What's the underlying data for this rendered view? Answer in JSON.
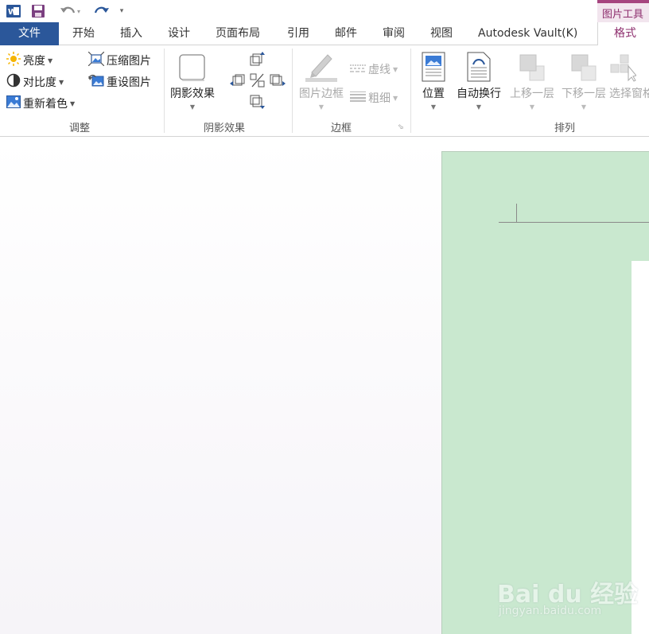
{
  "qat": {
    "app_icon": "word-icon",
    "save_icon": "save-icon",
    "undo_icon": "undo-icon",
    "redo_icon": "redo-icon",
    "customize_icon": "customize-arrow-icon",
    "context_tab_group": "图片工具"
  },
  "tabs": {
    "file": "文件",
    "home": "开始",
    "insert": "插入",
    "design": "设计",
    "layout": "页面布局",
    "references": "引用",
    "mailings": "邮件",
    "review": "审阅",
    "view": "视图",
    "vault": "Autodesk Vault(K)",
    "format": "格式"
  },
  "ribbon": {
    "adjust": {
      "label": "调整",
      "brightness": "亮度",
      "contrast": "对比度",
      "recolor": "重新着色",
      "compress": "压缩图片",
      "reset": "重设图片"
    },
    "shadow": {
      "label": "阴影效果",
      "shadow_effects": "阴影效果"
    },
    "border": {
      "label": "边框",
      "picture_border": "图片边框",
      "dashes": "虚线",
      "weight": "粗细"
    },
    "arrange": {
      "label": "排列",
      "position": "位置",
      "wrap_text": "自动换行",
      "bring_forward": "上移一层",
      "send_backward": "下移一层",
      "selection_pane": "选择窗格"
    }
  },
  "colors": {
    "file_tab": "#2b579a",
    "context_accent": "#a6447f",
    "canvas_green": "#c9e8cf"
  },
  "watermark": {
    "logo": "Bai du 经验",
    "url": "jingyan.baidu.com"
  }
}
